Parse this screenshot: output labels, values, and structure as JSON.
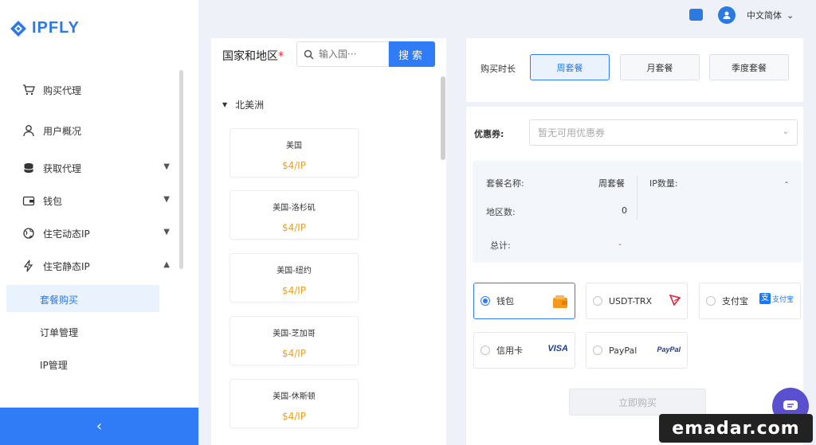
{
  "brand": {
    "logo_text": "IPFLY",
    "accent": "#2f7cf6",
    "price_color": "#f0a020"
  },
  "header": {
    "language": "中文简体"
  },
  "sidebar": {
    "items": [
      {
        "label": "购买代理",
        "icon": "cart-icon"
      },
      {
        "label": "用户概况",
        "icon": "user-icon"
      },
      {
        "label": "获取代理",
        "icon": "database-icon"
      },
      {
        "label": "钱包",
        "icon": "wallet-icon"
      },
      {
        "label": "住宅动态IP",
        "icon": "globe-icon"
      },
      {
        "label": "住宅静态IP",
        "icon": "lightning-icon"
      }
    ],
    "sub_items": [
      {
        "label": "套餐购买"
      },
      {
        "label": "订单管理"
      },
      {
        "label": "IP管理"
      }
    ],
    "collapse_glyph": "‹"
  },
  "country": {
    "title": "国家和地区",
    "required_mark": "*",
    "search_placeholder": "输入国···",
    "search_button": "搜索",
    "region": "北美洲",
    "cards": [
      {
        "name": "美国",
        "price": "$4/IP"
      },
      {
        "name": "美国-洛杉矶",
        "price": "$4/IP"
      },
      {
        "name": "美国-纽约",
        "price": "$4/IP"
      },
      {
        "name": "美国-芝加哥",
        "price": "$4/IP"
      },
      {
        "name": "美国-休斯顿",
        "price": "$4/IP"
      }
    ]
  },
  "duration": {
    "label": "购买时长",
    "options": [
      "周套餐",
      "月套餐",
      "季度套餐"
    ],
    "selected": "周套餐"
  },
  "coupon": {
    "label": "优惠券:",
    "placeholder": "暂无可用优惠券"
  },
  "summary": {
    "package_label": "套餐名称:",
    "package_value": "周套餐",
    "ip_count_label": "IP数量:",
    "ip_count_value": "-",
    "region_count_label": "地区数:",
    "region_count_value": "0",
    "total_label": "总计:",
    "total_value": "-"
  },
  "payment": {
    "methods": [
      {
        "label": "钱包",
        "logo": "wallet-orange-icon"
      },
      {
        "label": "USDT-TRX",
        "logo": "tron-icon"
      },
      {
        "label": "支付宝",
        "logo_text": "支付宝"
      },
      {
        "label": "信用卡",
        "logo_text": "VISA"
      },
      {
        "label": "PayPal",
        "logo_text": "PayPal"
      }
    ],
    "selected": "钱包"
  },
  "buy_button": "立即购买",
  "watermark": "emadar.com"
}
